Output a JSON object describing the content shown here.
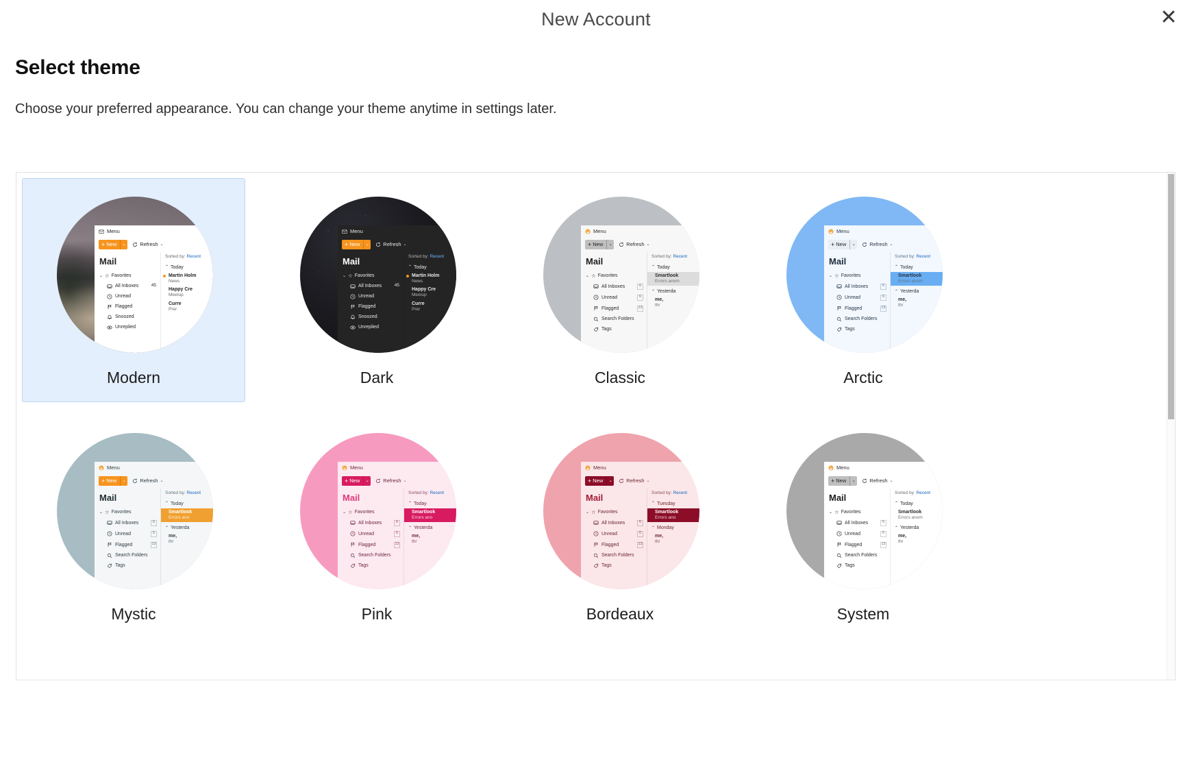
{
  "window": {
    "title": "New Account",
    "close_icon": "close-icon",
    "close_glyph": "✕"
  },
  "page": {
    "title": "Select theme",
    "subtitle": "Choose your preferred appearance. You can change your theme anytime in settings later."
  },
  "scrollbar": {
    "orientation": "vertical",
    "thumb_position": "top"
  },
  "preview_strings": {
    "menu": "Menu",
    "new": "New",
    "plus": "+",
    "refresh": "Refresh",
    "caret": "⌄",
    "mail": "Mail",
    "favorites": "Favorites",
    "sorted_by_label": "Sorted by:",
    "sorted_by_value": "Recent",
    "items": [
      {
        "label": "All Inboxes",
        "icon": "inbox-icon"
      },
      {
        "label": "Unread",
        "icon": "clock-icon"
      },
      {
        "label": "Flagged",
        "icon": "flag-icon"
      },
      {
        "label": "Snoozed",
        "icon": "bell-icon"
      },
      {
        "label": "Unreplied",
        "icon": "reply-icon"
      },
      {
        "label": "Search Folders",
        "icon": "search-icon"
      },
      {
        "label": "Tags",
        "icon": "tag-icon"
      }
    ]
  },
  "themes": [
    {
      "name": "Modern",
      "selected": true,
      "accent": "#f7941e",
      "new_button_bg": "#f7941e",
      "new_button_fg": "#ffffff",
      "panel_bg": "#ffffff",
      "text": "#242424",
      "muted": "#6a6a6a",
      "mail_title_color": "#242424",
      "link": "#1565c0",
      "app_icon": "envelope-icon",
      "app_icon_color": "#4a4a4a",
      "background_style": "photo-mountain",
      "sidebar": {
        "counts": {
          "All Inboxes": "45"
        },
        "visible_items": [
          "All Inboxes",
          "Unread",
          "Flagged",
          "Snoozed",
          "Unreplied"
        ],
        "badge_style": "plain-count"
      },
      "messages": [
        {
          "from": "Martin Holm",
          "subject": "News",
          "unread": true,
          "selected": false
        },
        {
          "from": "Happy Cre",
          "subject": "Meetup",
          "unread": false,
          "selected": false
        },
        {
          "from": "Curre",
          "subject": "Prer",
          "unread": false,
          "selected": false
        }
      ],
      "day_groups": [
        "Today"
      ]
    },
    {
      "name": "Dark",
      "selected": false,
      "accent": "#f7941e",
      "new_button_bg": "#f7941e",
      "new_button_fg": "#ffffff",
      "panel_bg": "#242424",
      "text": "#e8e8e8",
      "muted": "#b5b5b5",
      "mail_title_color": "#ffffff",
      "link": "#6cb6ff",
      "app_icon": "envelope-icon",
      "app_icon_color": "#c8c8c8",
      "background_style": "night-sky",
      "sidebar": {
        "counts": {
          "All Inboxes": "45"
        },
        "visible_items": [
          "All Inboxes",
          "Unread",
          "Flagged",
          "Snoozed",
          "Unreplied"
        ],
        "badge_style": "plain-count"
      },
      "messages": [
        {
          "from": "Martin Holm",
          "subject": "News",
          "unread": true,
          "selected": false
        },
        {
          "from": "Happy Cre",
          "subject": "Meetup",
          "unread": false,
          "selected": false
        },
        {
          "from": "Curre",
          "subject": "Prer",
          "unread": false,
          "selected": false
        }
      ],
      "day_groups": [
        "Today"
      ]
    },
    {
      "name": "Classic",
      "selected": false,
      "accent": "#f0a030",
      "new_button_bg": "#bfbfbf",
      "new_button_fg": "#1d1d1d",
      "panel_bg": "#f7f7f7",
      "text": "#2b2b2b",
      "muted": "#6f6f6f",
      "mail_title_color": "#1d1d1d",
      "link": "#1565c0",
      "app_icon": "smiley-mail-icon",
      "app_icon_color": "#f0a030",
      "background_style": "flat",
      "circle_color": "#bcbfc4",
      "sidebar": {
        "counts": {
          "All Inboxes": "6",
          "Unread": "6",
          "Flagged": "13"
        },
        "visible_items": [
          "All Inboxes",
          "Unread",
          "Flagged",
          "Search Folders",
          "Tags"
        ],
        "badge_style": "boxed"
      },
      "messages": [
        {
          "from": "Smartlook",
          "subject": "Errors anom",
          "unread": false,
          "selected": true
        },
        {
          "from": "me, ",
          "subject": "thr",
          "unread": false,
          "selected": false
        }
      ],
      "day_groups": [
        "Today",
        "Yesterda"
      ],
      "selected_row_bg": "#dcdcdc"
    },
    {
      "name": "Arctic",
      "selected": false,
      "accent": "#3b8fe0",
      "new_button_bg": "#e8eef4",
      "new_button_fg": "#1d1d1d",
      "panel_bg": "#f3f8fe",
      "text": "#263445",
      "muted": "#5d7389",
      "mail_title_color": "#1b2b3d",
      "link": "#1565c0",
      "app_icon": "smiley-mail-icon",
      "app_icon_color": "#f0a030",
      "background_style": "flat",
      "circle_color": "#7fb8f4",
      "sidebar": {
        "counts": {
          "All Inboxes": "6",
          "Unread": "6",
          "Flagged": "13"
        },
        "visible_items": [
          "All Inboxes",
          "Unread",
          "Flagged",
          "Search Folders",
          "Tags"
        ],
        "badge_style": "boxed"
      },
      "messages": [
        {
          "from": "Smartlook",
          "subject": "Errors anom",
          "unread": false,
          "selected": true
        },
        {
          "from": "me, ",
          "subject": "thr",
          "unread": false,
          "selected": false
        }
      ],
      "day_groups": [
        "Today",
        "Yesterda"
      ],
      "selected_row_bg": "#69aef2"
    },
    {
      "name": "Mystic",
      "selected": false,
      "accent": "#f7941e",
      "new_button_bg": "#f7941e",
      "new_button_fg": "#ffffff",
      "panel_bg": "#f4f6f7",
      "text": "#2b3b42",
      "muted": "#63787f",
      "mail_title_color": "#1f2e34",
      "link": "#1565c0",
      "app_icon": "smiley-mail-icon",
      "app_icon_color": "#f0a030",
      "background_style": "flat",
      "circle_color": "#a8bcc4",
      "sidebar": {
        "counts": {
          "All Inboxes": "6",
          "Unread": "6",
          "Flagged": "13"
        },
        "visible_items": [
          "All Inboxes",
          "Unread",
          "Flagged",
          "Search Folders",
          "Tags"
        ],
        "badge_style": "boxed"
      },
      "messages": [
        {
          "from": "Smartlook",
          "subject": "Errors ano",
          "unread": false,
          "selected": true
        },
        {
          "from": "me, ",
          "subject": "thr",
          "unread": false,
          "selected": false
        }
      ],
      "day_groups": [
        "Today",
        "Yesterda"
      ],
      "selected_row_bg": "#f0a030"
    },
    {
      "name": "Pink",
      "selected": false,
      "accent": "#d81b60",
      "new_button_bg": "#d81b60",
      "new_button_fg": "#ffffff",
      "panel_bg": "#fdeaf1",
      "text": "#6d2140",
      "muted": "#8d4a64",
      "mail_title_color": "#e0397a",
      "link": "#1565c0",
      "app_icon": "smiley-mail-icon",
      "app_icon_color": "#f0a030",
      "background_style": "flat",
      "circle_color": "#f79ac0",
      "sidebar": {
        "counts": {
          "All Inboxes": "6",
          "Unread": "6",
          "Flagged": "13"
        },
        "visible_items": [
          "All Inboxes",
          "Unread",
          "Flagged",
          "Search Folders",
          "Tags"
        ],
        "badge_style": "boxed"
      },
      "messages": [
        {
          "from": "Smartlook",
          "subject": "Errors ano",
          "unread": false,
          "selected": true
        },
        {
          "from": "me, ",
          "subject": "thr",
          "unread": false,
          "selected": false
        }
      ],
      "day_groups": [
        "Today",
        "Yesterda"
      ],
      "selected_row_bg": "#d81b60"
    },
    {
      "name": "Bordeaux",
      "selected": false,
      "accent": "#8c0d28",
      "new_button_bg": "#8c0d28",
      "new_button_fg": "#ffffff",
      "panel_bg": "#fbe7e9",
      "text": "#6b2330",
      "muted": "#8d5159",
      "mail_title_color": "#a01b35",
      "link": "#1565c0",
      "app_icon": "smiley-mail-icon",
      "app_icon_color": "#f0a030",
      "background_style": "flat",
      "circle_color": "#efa3ac",
      "sidebar": {
        "counts": {
          "All Inboxes": "6",
          "Unread": "6",
          "Flagged": "13"
        },
        "visible_items": [
          "All Inboxes",
          "Unread",
          "Flagged",
          "Search Folders",
          "Tags"
        ],
        "badge_style": "boxed"
      },
      "messages": [
        {
          "from": "Smartlook",
          "subject": "Errors ano",
          "unread": false,
          "selected": true
        },
        {
          "from": "me, ",
          "subject": "thr",
          "unread": false,
          "selected": false
        }
      ],
      "day_groups": [
        "Tuesday",
        "Monday"
      ],
      "selected_row_bg": "#8c0d28"
    },
    {
      "name": "System",
      "selected": false,
      "accent": "#f0a030",
      "new_button_bg": "#bfbfbf",
      "new_button_fg": "#1d1d1d",
      "panel_bg": "#ffffff",
      "text": "#2b2b2b",
      "muted": "#6f6f6f",
      "mail_title_color": "#1d1d1d",
      "link": "#1565c0",
      "app_icon": "smiley-mail-icon",
      "app_icon_color": "#f0a030",
      "background_style": "flat",
      "circle_color": "#a9a9a9",
      "sidebar": {
        "counts": {
          "All Inboxes": "6",
          "Unread": "6",
          "Flagged": "13"
        },
        "visible_items": [
          "All Inboxes",
          "Unread",
          "Flagged",
          "Search Folders",
          "Tags"
        ],
        "badge_style": "boxed"
      },
      "messages": [
        {
          "from": "Smartlook",
          "subject": "Errors anom",
          "unread": false,
          "selected": false
        },
        {
          "from": "me, ",
          "subject": "thr",
          "unread": false,
          "selected": false
        }
      ],
      "day_groups": [
        "Today",
        "Yesterda"
      ],
      "selected_row_bg": "#e0e0e0"
    }
  ]
}
